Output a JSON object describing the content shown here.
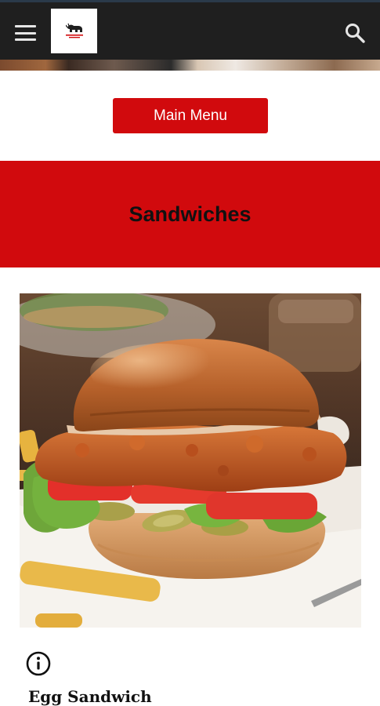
{
  "header": {
    "menu_icon": "hamburger-menu-icon",
    "logo_icon": "bull-logo-icon",
    "search_icon": "search-icon",
    "colors": {
      "background": "#1f1f1f",
      "icon": "#e6e6e6"
    }
  },
  "main_menu_button": {
    "label": "Main Menu",
    "color": "#d10a0d"
  },
  "category": {
    "title": "Sandwiches",
    "band_color": "#d10a0d"
  },
  "product": {
    "image_subject": "fried-chicken-sandwich-photo",
    "info_icon": "info-icon",
    "name": "Egg Sandwich"
  }
}
